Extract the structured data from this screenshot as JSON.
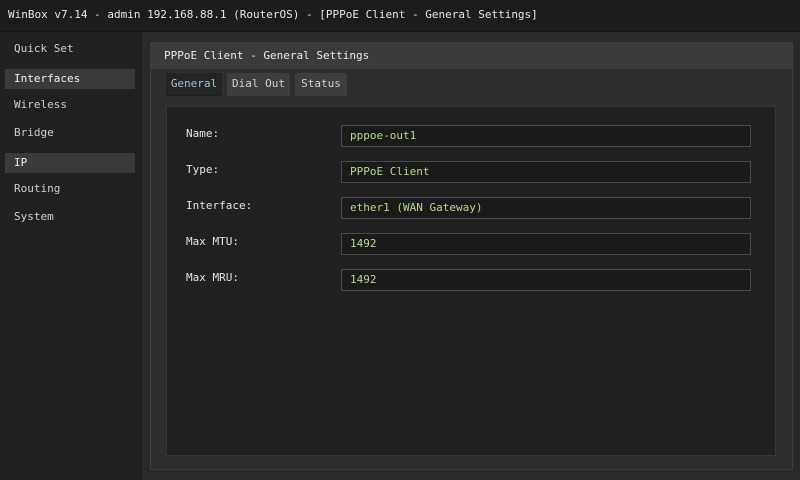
{
  "window_title": "WinBox v7.14 - admin 192.168.88.1 (RouterOS) - [PPPoE Client - General Settings]",
  "sidebar": {
    "items": [
      {
        "label": "Quick Set",
        "active": false
      },
      {
        "label": "Interfaces",
        "active": true
      },
      {
        "label": "Wireless",
        "active": false
      },
      {
        "label": "Bridge",
        "active": false
      },
      {
        "label": "IP",
        "active": true
      },
      {
        "label": "Routing",
        "active": false
      },
      {
        "label": "System",
        "active": false
      }
    ]
  },
  "dialog": {
    "title": "PPPoE Client - General Settings",
    "tabs": [
      {
        "label": "General",
        "active": true
      },
      {
        "label": "Dial Out",
        "active": false
      },
      {
        "label": "Status",
        "active": false
      }
    ],
    "fields": [
      {
        "label": "Name:",
        "value": "pppoe-out1"
      },
      {
        "label": "Type:",
        "value": "PPPoE Client"
      },
      {
        "label": "Interface:",
        "value": "ether1 (WAN Gateway)"
      },
      {
        "label": "Max MTU:",
        "value": "1492"
      },
      {
        "label": "Max MRU:",
        "value": "1492"
      }
    ]
  },
  "colors": {
    "background": "#262626",
    "value_text": "#b7d98a",
    "active_tab_text": "#9ec6d6",
    "active_sidebar_bg": "#3a3a3a"
  }
}
